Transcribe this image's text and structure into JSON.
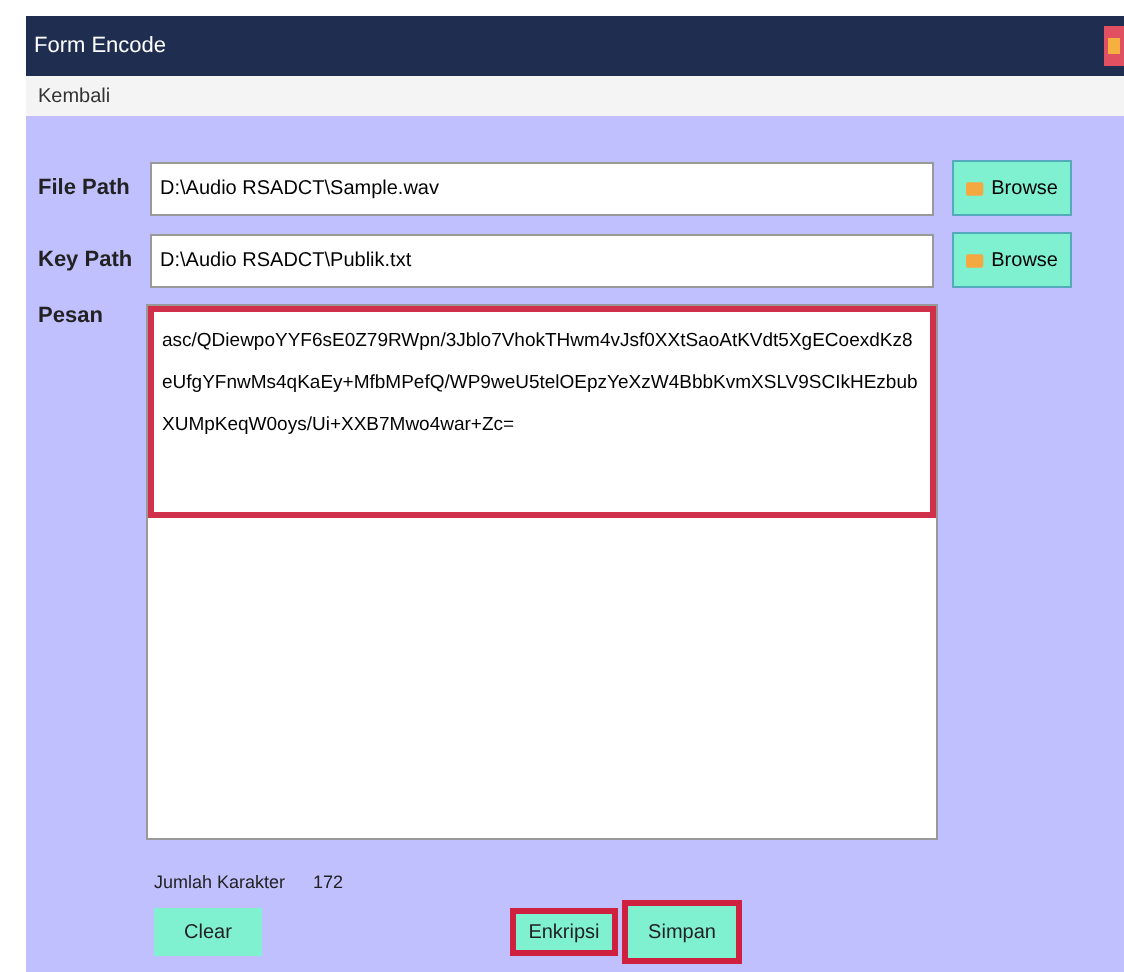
{
  "window": {
    "title": "Form Encode"
  },
  "menu": [
    "Kembali"
  ],
  "fields": [
    {
      "label": "File Path",
      "value": "D:\\Audio RSADCT\\Sample.wav",
      "button": "Browse"
    },
    {
      "label": "Key Path",
      "value": "D:\\Audio RSADCT\\Publik.txt",
      "button": "Browse"
    }
  ],
  "message": {
    "label": "Pesan",
    "value": "asc/QDiewpoYYF6sE0Z79RWpn/3Jblo7VhokTHwm4vJsf0XXtSaoAtKVdt5XgECoexdKz8eUfgYFnwMs4qKaEy+MfbMPefQ/WP9weU5telOEpzYeXzW4BbbKvmXSLV9SCIkHEzbub XUMpKeqW0oys/Ui+XXB7Mwo4war+Zc=",
    "highlighted": true
  },
  "counter": {
    "label": "Jumlah Karakter",
    "value": "172"
  },
  "buttons": [
    {
      "label": "Clear",
      "highlighted": false
    },
    {
      "label": "Enkripsi",
      "highlighted": true
    },
    {
      "label": "Simpan",
      "highlighted": true
    }
  ]
}
